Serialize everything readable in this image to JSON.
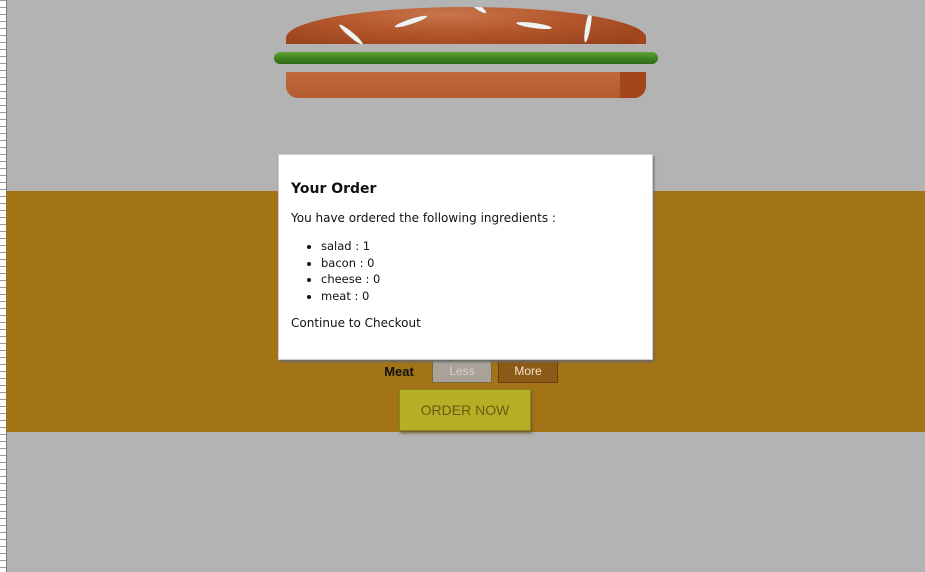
{
  "modal": {
    "title": "Your Order",
    "intro": "You have ordered the following ingredients :",
    "items": [
      {
        "text": "salad : 1"
      },
      {
        "text": "bacon : 0"
      },
      {
        "text": "cheese : 0"
      },
      {
        "text": "meat : 0"
      }
    ],
    "continue_text": "Continue to Checkout"
  },
  "controls": {
    "meat": {
      "label": "Meat",
      "less_label": "Less",
      "more_label": "More"
    }
  },
  "order_button": {
    "label": "ORDER NOW"
  },
  "colors": {
    "backdrop": "#b3b3b3",
    "controls_panel": "#a37416",
    "order_button": "#b6ae25",
    "bread": "#b35a2f",
    "salad": "#3b7f1f"
  }
}
